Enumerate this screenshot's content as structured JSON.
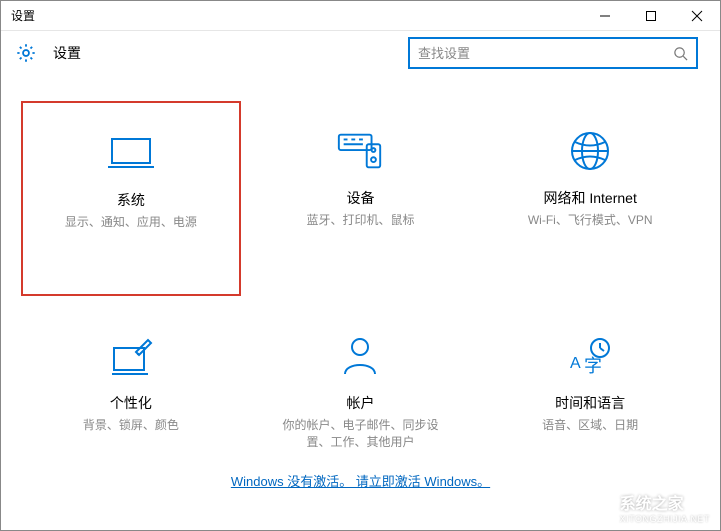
{
  "window": {
    "title": "设置"
  },
  "header": {
    "title": "设置"
  },
  "search": {
    "placeholder": "查找设置"
  },
  "tiles": [
    {
      "title": "系统",
      "desc": "显示、通知、应用、电源"
    },
    {
      "title": "设备",
      "desc": "蓝牙、打印机、鼠标"
    },
    {
      "title": "网络和 Internet",
      "desc": "Wi-Fi、飞行模式、VPN"
    },
    {
      "title": "个性化",
      "desc": "背景、锁屏、颜色"
    },
    {
      "title": "帐户",
      "desc": "你的帐户、电子邮件、同步设置、工作、其他用户"
    },
    {
      "title": "时间和语言",
      "desc": "语音、区域、日期"
    }
  ],
  "activation": {
    "text": "Windows 没有激活。 请立即激活 Windows。"
  },
  "watermark": {
    "main": "系统之家",
    "sub": "XITONGZHIJIA.NET"
  }
}
